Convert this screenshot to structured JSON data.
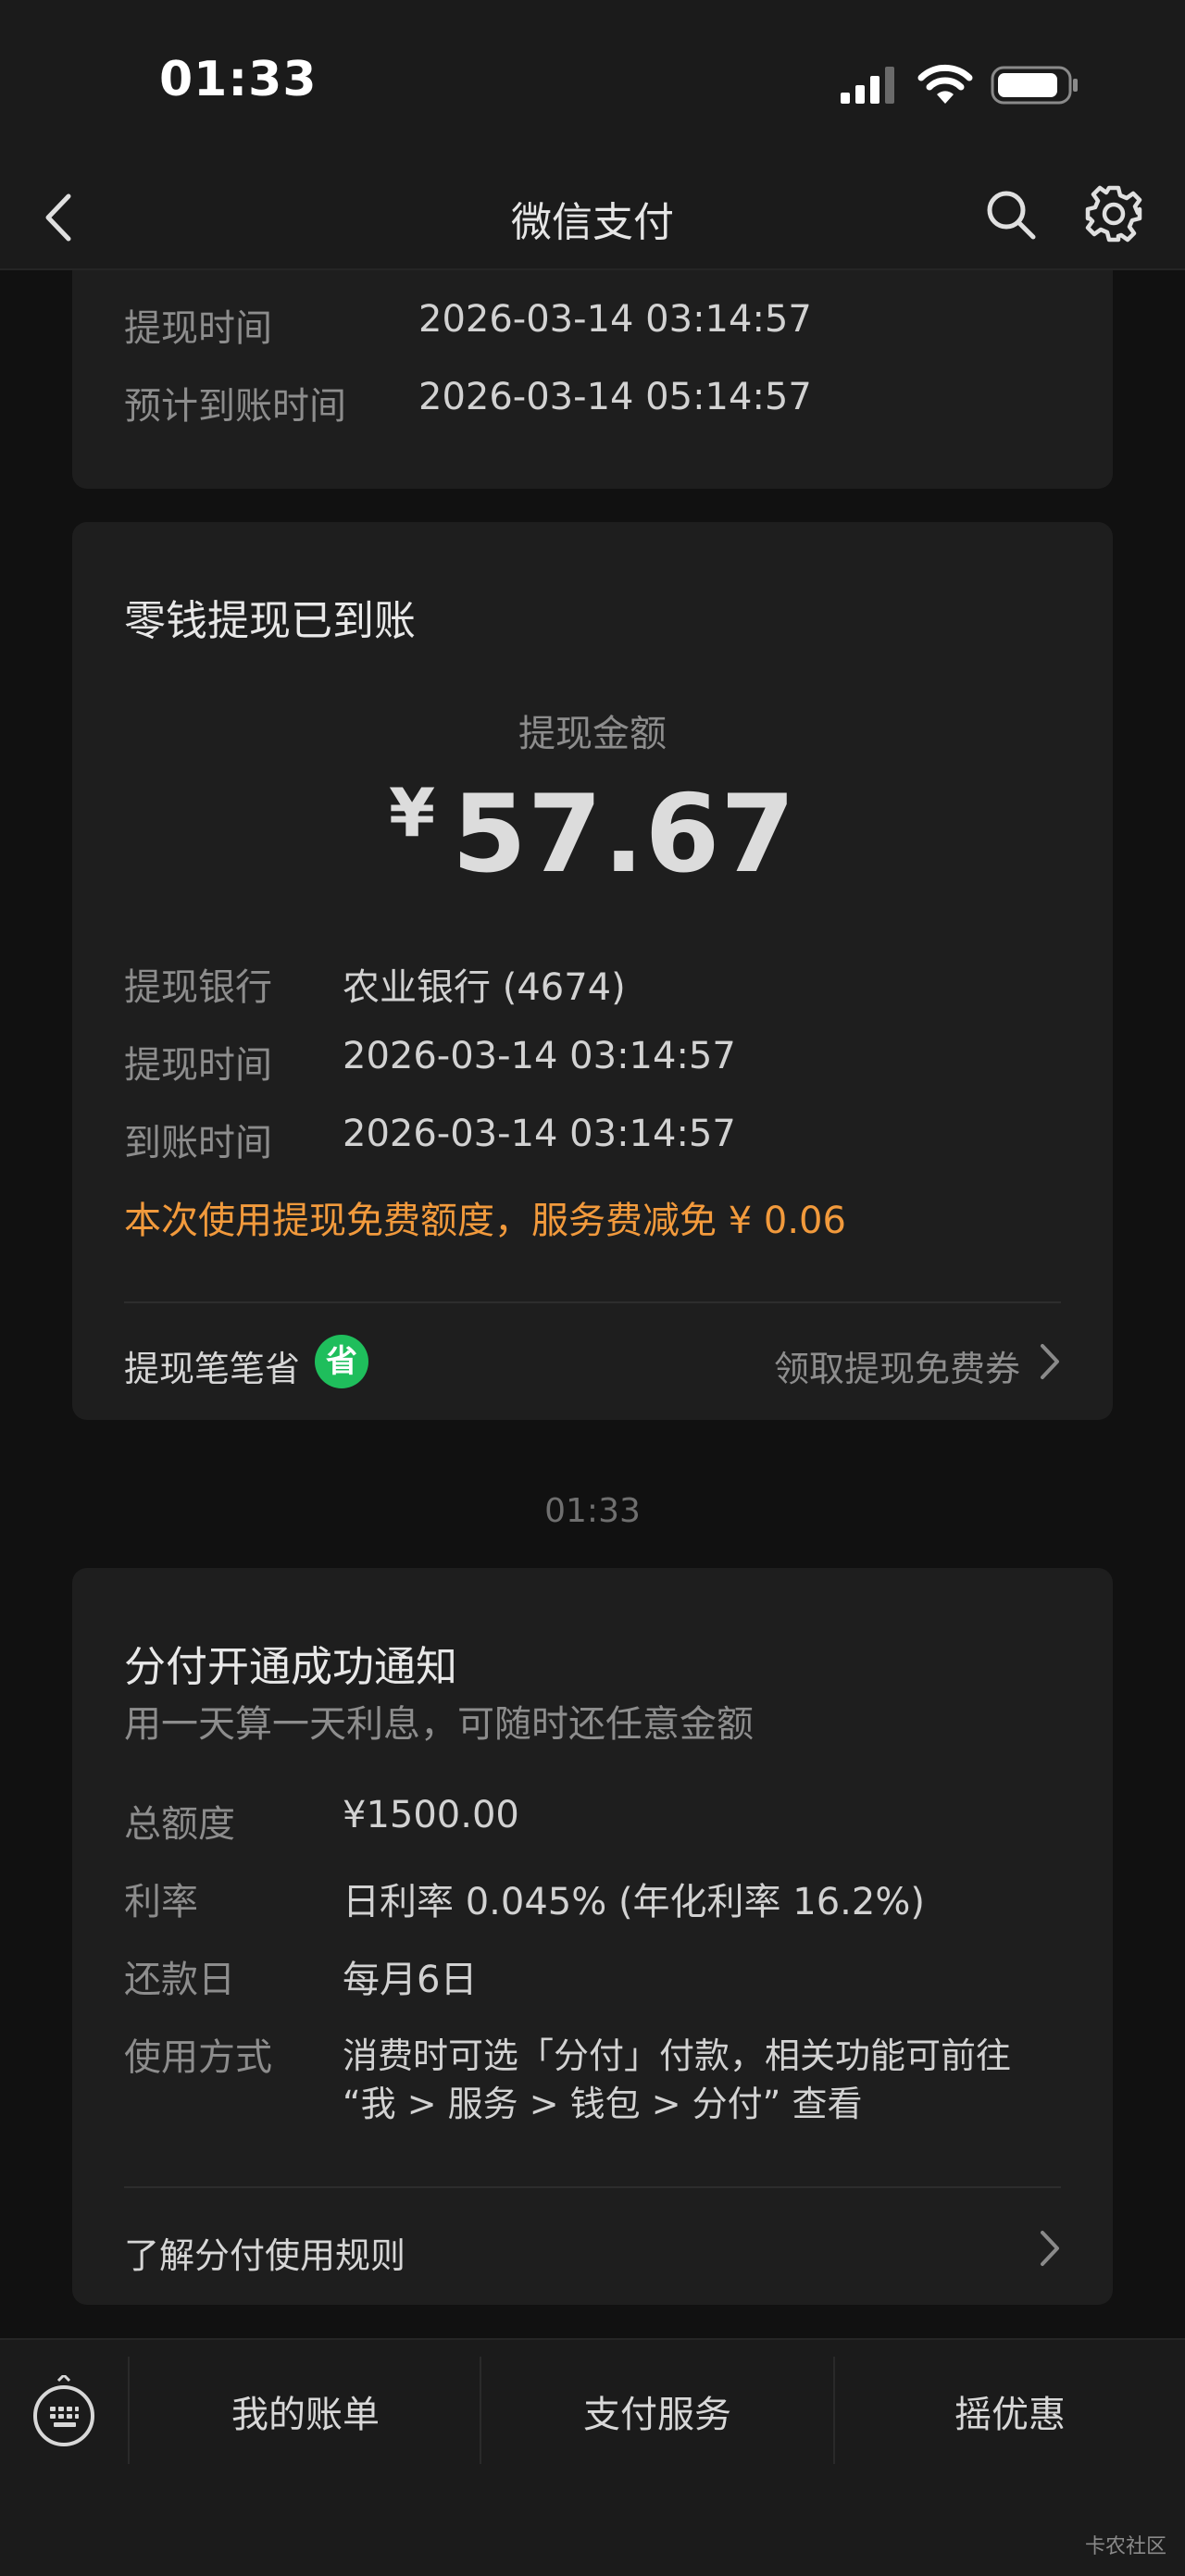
{
  "status_bar": {
    "time": "01:33"
  },
  "nav": {
    "title": "微信支付"
  },
  "card_previous": {
    "rows": [
      {
        "label": "提现时间",
        "value": "2026-03-14 03:14:57"
      },
      {
        "label": "预计到账时间",
        "value": "2026-03-14 05:14:57"
      }
    ]
  },
  "card_withdraw": {
    "title": "零钱提现已到账",
    "amount_label": "提现金额",
    "currency": "¥",
    "amount": "57.67",
    "rows": [
      {
        "label": "提现银行",
        "value": "农业银行 (4674)"
      },
      {
        "label": "提现时间",
        "value": "2026-03-14 03:14:57"
      },
      {
        "label": "到账时间",
        "value": "2026-03-14 03:14:57"
      }
    ],
    "promo": "本次使用提现免费额度，服务费减免 ¥ 0.06",
    "footer_left": "提现笔笔省",
    "badge": "省",
    "footer_right": "领取提现免费券",
    "accent_color": "#f29a3c",
    "badge_color": "#1fbe5c"
  },
  "timestamp": "01:33",
  "card_fenfu": {
    "title": "分付开通成功通知",
    "subtitle": "用一天算一天利息，可随时还任意金额",
    "rows": [
      {
        "label": "总额度",
        "value": "¥1500.00"
      },
      {
        "label": "利率",
        "value": "日利率 0.045% (年化利率 16.2%)"
      },
      {
        "label": "还款日",
        "value": "每月6日"
      },
      {
        "label": "使用方式",
        "value_line1": "消费时可选「分付」付款，相关功能可前往",
        "value_line2": "“我 > 服务 > 钱包 > 分付” 查看"
      }
    ],
    "footer": "了解分付使用规则"
  },
  "bottom_bar": {
    "items": [
      "我的账单",
      "支付服务",
      "摇优惠"
    ]
  },
  "watermark": "卡农社区"
}
